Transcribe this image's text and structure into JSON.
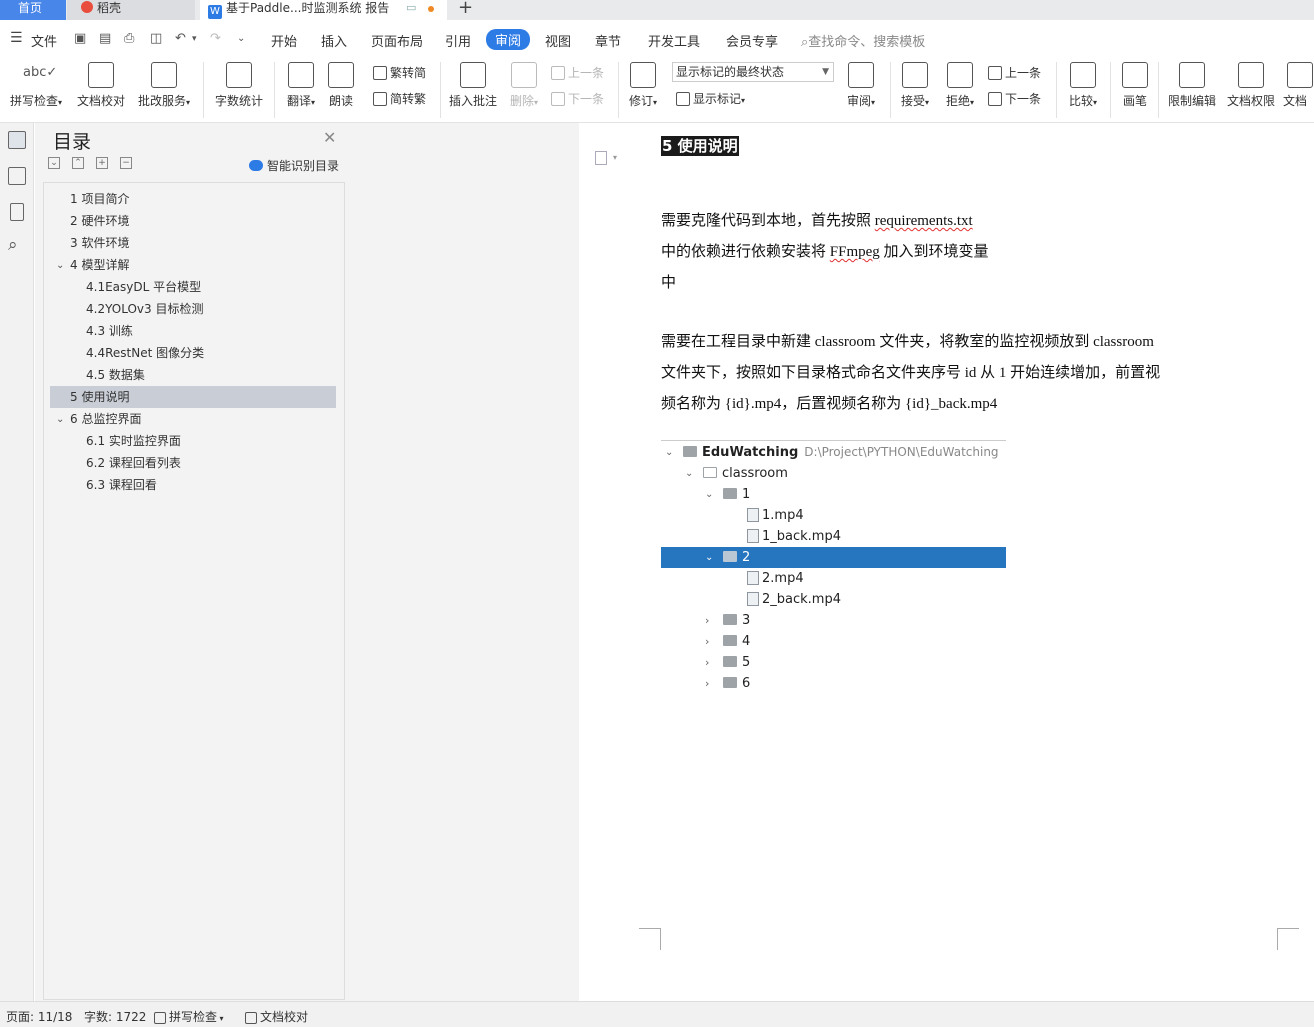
{
  "tabs": {
    "home": "首页",
    "daoke": "稻壳",
    "document": "基于Paddle...时监测系统 报告",
    "new_tab": "+"
  },
  "menu": {
    "file": "文件",
    "items": [
      "开始",
      "插入",
      "页面布局",
      "引用",
      "审阅",
      "视图",
      "章节",
      "开发工具",
      "会员专享"
    ],
    "active": "审阅",
    "search_placeholder": "查找命令、搜索模板"
  },
  "ribbon": {
    "spell_check": "拼写检查",
    "doc_proof": "文档校对",
    "revise_service": "批改服务",
    "word_count": "字数统计",
    "translate": "翻译",
    "read_aloud": "朗读",
    "trad_to_simp": "繁转简",
    "simp_to_trad": "简转繁",
    "insert_comment": "插入批注",
    "delete": "删除",
    "prev_comment": "上一条",
    "next_comment": "下一条",
    "revise": "修订",
    "display_mode": "显示标记的最终状态",
    "show_marks": "显示标记",
    "review": "审阅",
    "accept": "接受",
    "reject": "拒绝",
    "prev_change": "上一条",
    "next_change": "下一条",
    "compare": "比较",
    "pen": "画笔",
    "restrict_edit": "限制编辑",
    "doc_permission": "文档权限",
    "doc_cut": "文档"
  },
  "toc": {
    "title": "目录",
    "smart_label": "智能识别目录",
    "items": [
      {
        "label": "1 项目简介"
      },
      {
        "label": "2 硬件环境"
      },
      {
        "label": "3 软件环境"
      },
      {
        "label": "4 模型详解"
      },
      {
        "label": "4.1EasyDL 平台模型"
      },
      {
        "label": "4.2YOLOv3 目标检测"
      },
      {
        "label": "4.3 训练"
      },
      {
        "label": "4.4RestNet 图像分类"
      },
      {
        "label": "4.5 数据集"
      },
      {
        "label": "5 使用说明"
      },
      {
        "label": "6 总监控界面"
      },
      {
        "label": "6.1 实时监控界面"
      },
      {
        "label": "6.2 课程回看列表"
      },
      {
        "label": "6.3 课程回看"
      }
    ],
    "selected": "5 使用说明"
  },
  "document": {
    "heading": "5 使用说明",
    "p1_line1_a": "需要克隆代码到本地，首先按照 ",
    "p1_line1_b": "requirements.txt",
    "p1_line2_a": "中的依赖进行依赖安装将 ",
    "p1_line2_b": "FFmpeg",
    "p1_line2_c": " 加入到环境变量",
    "p1_line3": "中",
    "p2_line1": "需要在工程目录中新建 classroom 文件夹，将教室的监控视频放到 classroom",
    "p2_line2": "文件夹下，按照如下目录格式命名文件夹序号 id 从 1 开始连续增加，前置视",
    "p2_line3": "频名称为 {id}.mp4，后置视频名称为 {id}_back.mp4"
  },
  "tree": {
    "root": "EduWatching",
    "root_path": "D:\\Project\\PYTHON\\EduWatching",
    "classroom": "classroom",
    "folder1": "1",
    "file1a": "1.mp4",
    "file1b": "1_back.mp4",
    "folder2": "2",
    "file2a": "2.mp4",
    "file2b": "2_back.mp4",
    "folder3": "3",
    "folder4": "4",
    "folder5": "5",
    "folder6": "6"
  },
  "status": {
    "page": "页面: 11/18",
    "words": "字数: 1722",
    "spell": "拼写检查",
    "proof": "文档校对"
  },
  "colors": {
    "accent": "#2d7be5",
    "tree_selection": "#2675bf",
    "toc_selection": "#c9ced6"
  }
}
